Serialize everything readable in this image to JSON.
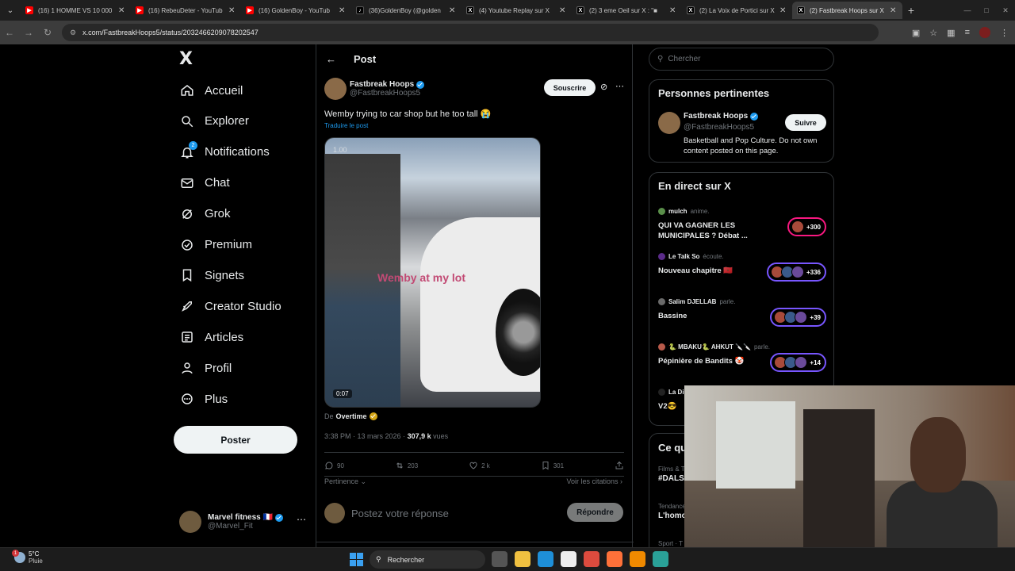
{
  "browser": {
    "tabs": [
      {
        "label": "(16) 1 HOMME VS 10 000",
        "icon": "youtube-icon",
        "active": false
      },
      {
        "label": "(16) RebeuDeter - YouTub",
        "icon": "youtube-icon",
        "active": false
      },
      {
        "label": "(16) GoldenBoy - YouTub",
        "icon": "youtube-icon",
        "active": false
      },
      {
        "label": "(36)GoldenBoy (@golden",
        "icon": "tiktok-icon",
        "active": false
      },
      {
        "label": "(4) Youtube Replay sur X",
        "icon": "x-icon",
        "active": false
      },
      {
        "label": "(2) 3 eme Oeil sur X : \"■",
        "icon": "x-icon",
        "active": false
      },
      {
        "label": "(2) La Voix de Portici sur X",
        "icon": "x-icon",
        "active": false
      },
      {
        "label": "(2) Fastbreak Hoops sur X",
        "icon": "x-icon",
        "active": true
      }
    ],
    "url": "x.com/FastbreakHoops5/status/2032466209078202547"
  },
  "leftnav": {
    "logo": "X",
    "items": [
      {
        "label": "Accueil",
        "icon": "home-icon"
      },
      {
        "label": "Explorer",
        "icon": "search-icon"
      },
      {
        "label": "Notifications",
        "icon": "bell-icon",
        "badge": "2"
      },
      {
        "label": "Chat",
        "icon": "mail-icon"
      },
      {
        "label": "Grok",
        "icon": "grok-icon"
      },
      {
        "label": "Premium",
        "icon": "premium-icon"
      },
      {
        "label": "Signets",
        "icon": "bookmark-icon"
      },
      {
        "label": "Creator Studio",
        "icon": "rocket-icon"
      },
      {
        "label": "Articles",
        "icon": "article-icon"
      },
      {
        "label": "Profil",
        "icon": "person-icon"
      },
      {
        "label": "Plus",
        "icon": "more-circle-icon"
      }
    ],
    "post_button": "Poster",
    "account": {
      "name": "Marvel fitness 🇫🇷",
      "handle": "@Marvel_Fit"
    }
  },
  "main": {
    "title": "Post",
    "author": {
      "name": "Fastbreak Hoops",
      "handle": "@FastbreakHoops5"
    },
    "subscribe": "Souscrire",
    "text": "Wemby trying to car shop but he too tall 😭",
    "translate": "Traduire le post",
    "video": {
      "overlay": "Wemby at my lot",
      "speed": "1.00",
      "duration": "0:07"
    },
    "from_prefix": "De",
    "from_name": "Overtime",
    "time": "3:38 PM · 13 mars 2026 ·",
    "views": "307,9 k",
    "views_label": "vues",
    "stats": {
      "replies": "90",
      "reposts": "203",
      "likes": "2 k",
      "bookmarks": "301"
    },
    "sort": "Pertinence",
    "citations": "Voir les citations",
    "reply_placeholder": "Postez votre réponse",
    "reply_button": "Répondre"
  },
  "right": {
    "search_placeholder": "Chercher",
    "relevant": {
      "title": "Personnes pertinentes",
      "name": "Fastbreak Hoops",
      "handle": "@FastbreakHoops5",
      "bio": "Basketball and Pop Culture. Do not own content posted on this page.",
      "follow": "Suivre"
    },
    "live": {
      "title": "En direct sur X",
      "items": [
        {
          "host": "mulch",
          "verb": "anime.",
          "title": "QUI VA GAGNER LES MUNICIPALES ? Débat ...",
          "count": "+300",
          "color": "#f91880",
          "dot": "#5a8f4a"
        },
        {
          "host": "Le Talk So",
          "verb": "écoute.",
          "title": "Nouveau chapitre 🇲🇦",
          "count": "+336",
          "color": "#7856ff",
          "dot": "#5b2b8a"
        },
        {
          "host": "Salim DJELLAB",
          "verb": "parle.",
          "title": "Bassine",
          "count": "+39",
          "color": "#7856ff",
          "dot": "#6a6a6a"
        },
        {
          "host": "🐍 MBAKU🐍 AHKUT 🔪🔪",
          "verb": "parle.",
          "title": "Pépinière de Bandits 🤡",
          "count": "+14",
          "color": "#7856ff",
          "dot": "#b85a4a"
        },
        {
          "host": "La Di",
          "verb": "",
          "title": "V2😎",
          "count": "",
          "color": "#7856ff",
          "dot": "#222"
        }
      ]
    },
    "trends": {
      "title": "Ce qu",
      "items": [
        {
          "meta": "Films & T",
          "name": "#DALS"
        },
        {
          "meta": "Tendance",
          "name": "L'homo"
        },
        {
          "meta": "Sport · T",
          "name": "#OMA"
        }
      ]
    }
  },
  "taskbar": {
    "temp": "5°C",
    "weather": "Pluie",
    "weather_badge": "1",
    "search": "Rechercher"
  }
}
